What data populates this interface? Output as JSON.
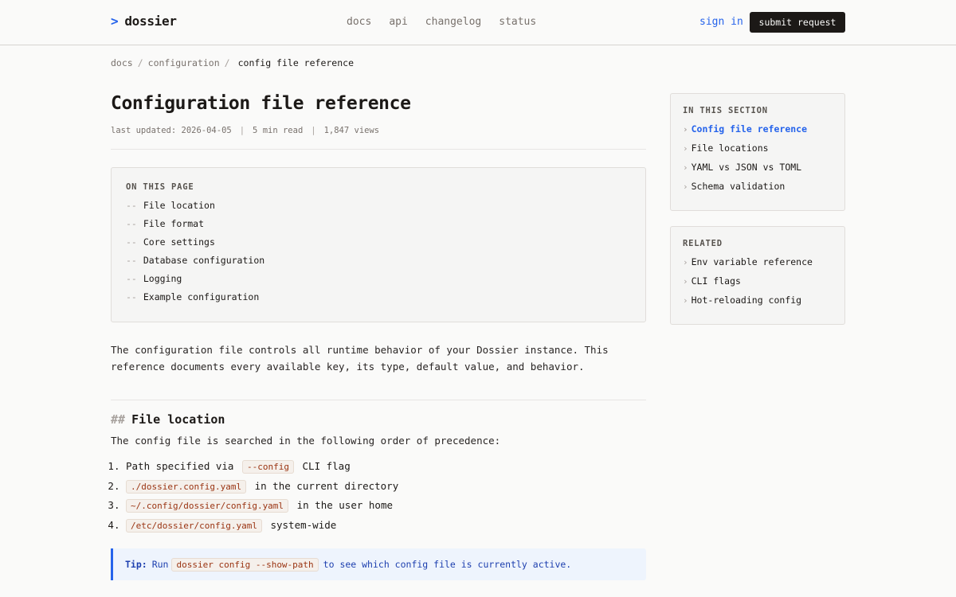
{
  "header": {
    "brand_prompt": ">",
    "brand": "dossier",
    "nav": [
      "docs",
      "api",
      "changelog",
      "status"
    ],
    "sign_in": "sign in",
    "submit": "submit request"
  },
  "breadcrumb": {
    "items": [
      "docs",
      "configuration"
    ],
    "current": "config file reference"
  },
  "page": {
    "title": "Configuration file reference",
    "meta": [
      "last updated: 2026-04-05",
      "5 min read",
      "1,847 views"
    ],
    "meta_sep": "|"
  },
  "toc": {
    "title": "ON THIS PAGE",
    "dash": "--",
    "items": [
      "File location",
      "File format",
      "Core settings",
      "Database configuration",
      "Logging",
      "Example configuration"
    ]
  },
  "intro": "The configuration file controls all runtime behavior of your Dossier instance. This reference documents every available key, its type, default value, and behavior.",
  "section": {
    "hash": "##",
    "title": "File location",
    "intro": "The config file is searched in the following order of precedence:",
    "list": [
      {
        "code": "--config",
        "text": "CLI flag",
        "prefix": "Path specified via"
      },
      {
        "code": "./dossier.config.yaml",
        "text": "in the current directory",
        "prefix": ""
      },
      {
        "code": "~/.config/dossier/config.yaml",
        "text": "in the user home",
        "prefix": ""
      },
      {
        "code": "/etc/dossier/config.yaml",
        "text": "system-wide",
        "prefix": ""
      }
    ],
    "tip": {
      "label": "Tip:",
      "before": "Run",
      "code": "dossier config --show-path",
      "after": "to see which config file is currently active."
    }
  },
  "sidebar": {
    "section": {
      "title": "IN THIS SECTION",
      "items": [
        "Config file reference",
        "File locations",
        "YAML vs JSON vs TOML",
        "Schema validation"
      ]
    },
    "related": {
      "title": "RELATED",
      "items": [
        "Env variable reference",
        "CLI flags",
        "Hot-reloading config"
      ]
    }
  },
  "colors": {
    "accent": "#2563eb",
    "code_text": "#9a3412",
    "dark": "#1c1917"
  }
}
